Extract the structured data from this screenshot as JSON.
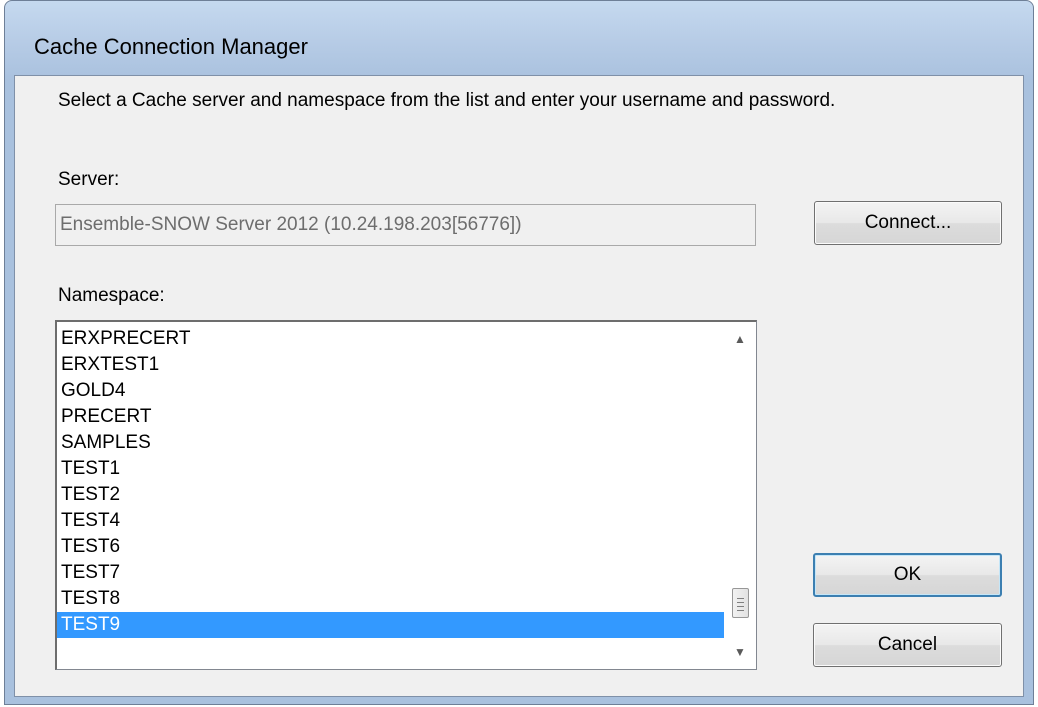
{
  "window": {
    "title": "Cache Connection Manager"
  },
  "dialog": {
    "instructions": "Select a Cache server and namespace from the list and enter your username and password.",
    "server_label": "Server:",
    "server_value": "Ensemble-SNOW Server 2012 (10.24.198.203[56776])",
    "connect_button": "Connect...",
    "namespace_label": "Namespace:",
    "namespaces": [
      "ERXPRECERT",
      "ERXTEST1",
      "GOLD4",
      "PRECERT",
      "SAMPLES",
      "TEST1",
      "TEST2",
      "TEST4",
      "TEST6",
      "TEST7",
      "TEST8",
      "TEST9"
    ],
    "selected_namespace": "TEST9",
    "ok_button": "OK",
    "cancel_button": "Cancel"
  },
  "icons": {
    "scroll_up": "scroll-up-arrow-icon",
    "scroll_down": "scroll-down-arrow-icon",
    "scroll_grip": "scrollbar-grip-icon"
  },
  "colors": {
    "selection": "#3399ff",
    "dialog_bg": "#f0f0f0",
    "titlebar": "#b9cde6"
  }
}
